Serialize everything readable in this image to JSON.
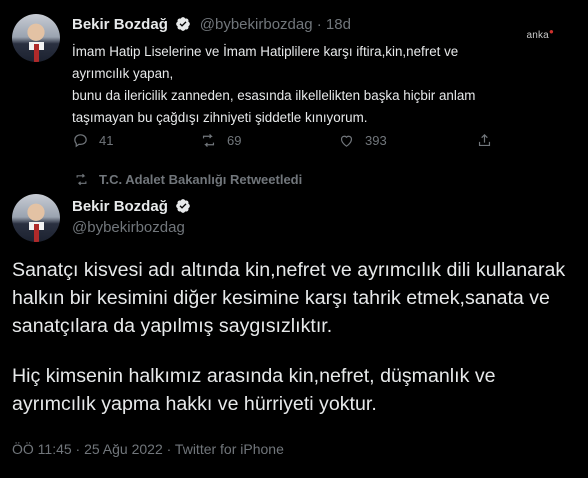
{
  "watermark": "anka",
  "tweet1": {
    "name": "Bekir Bozdağ",
    "handle_time": "@bybekirbozdag · 18d",
    "lines": [
      "İmam Hatip Liselerine ve İmam Hatiplilere karşı iftira,kin,nefret ve",
      "ayrımcılık yapan,",
      "bunu da ilericilik zanneden, esasında ilkellelikten başka hiçbir anlam",
      "taşımayan bu çağdışı zihniyeti şiddetle kınıyorum."
    ],
    "reply_count": "41",
    "retweet_count": "69",
    "like_count": "393"
  },
  "retweeted_by": "T.C. Adalet Bakanlığı Retweetledi",
  "tweet2": {
    "name": "Bekir Bozdağ",
    "handle": "@bybekirbozdag",
    "paragraph1": "Sanatçı kisvesi adı altında kin,nefret ve ayrımcılık dili kullanarak halkın bir kesimini diğer kesimine karşı tahrik etmek,sanata ve sanatçılara da yapılmış saygısızlıktır.",
    "paragraph2": "Hiç kimsenin halkımız arasında kin,nefret, düşmanlık ve ayrımcılık yapma hakkı ve hürriyeti yoktur.",
    "meta": "ÖÖ 11:45 · 25 Ağu 2022 · Twitter for iPhone"
  },
  "icons": [
    "verified-badge-icon",
    "reply-icon",
    "retweet-icon",
    "like-icon",
    "share-icon",
    "more-icon"
  ],
  "colors": {
    "background": "#000000",
    "text": "#e7e9ea",
    "muted": "#71767b",
    "verified": "#1d9bf0",
    "watermark_accent": "#d0312d"
  }
}
